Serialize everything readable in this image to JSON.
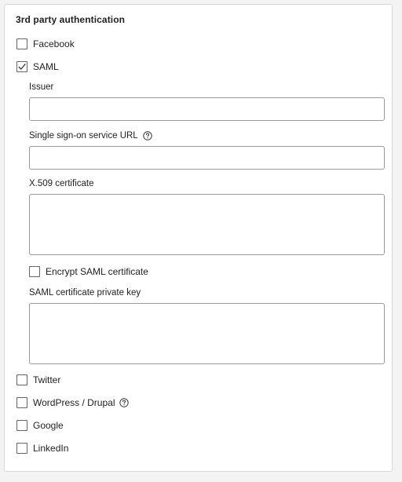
{
  "section": {
    "title": "3rd party authentication"
  },
  "providers": {
    "facebook": {
      "label": "Facebook",
      "checked": false
    },
    "saml": {
      "label": "SAML",
      "checked": true
    },
    "twitter": {
      "label": "Twitter",
      "checked": false
    },
    "wordpress": {
      "label": "WordPress / Drupal",
      "checked": false
    },
    "google": {
      "label": "Google",
      "checked": false
    },
    "linkedin": {
      "label": "LinkedIn",
      "checked": false
    }
  },
  "saml": {
    "issuer": {
      "label": "Issuer",
      "value": ""
    },
    "sso_url": {
      "label": "Single sign-on service URL",
      "value": ""
    },
    "certificate": {
      "label": "X.509 certificate",
      "value": ""
    },
    "encrypt": {
      "label": "Encrypt SAML certificate",
      "checked": false
    },
    "private_key": {
      "label": "SAML certificate private key",
      "value": ""
    }
  },
  "icons": {
    "checkmark": "checkmark-icon",
    "help": "help-circle-icon"
  },
  "colors": {
    "panel_bg": "#ffffff",
    "page_bg": "#f3f3f3",
    "border": "#9a9a9a",
    "text": "#222222"
  }
}
